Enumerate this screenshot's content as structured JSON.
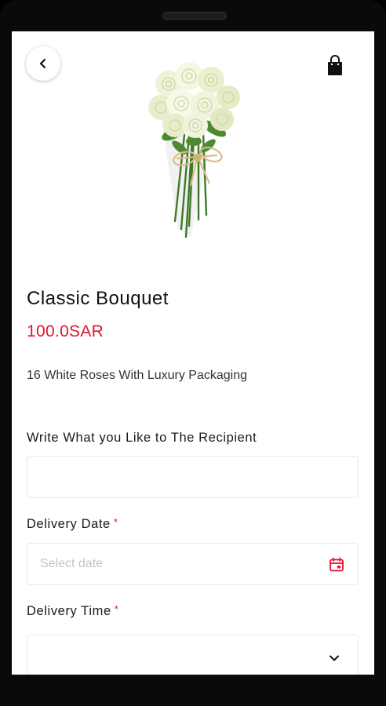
{
  "product": {
    "name": "Classic Bouquet",
    "price": "100.0SAR",
    "description": "16 White Roses With Luxury Packaging"
  },
  "form": {
    "message_label": "Write What you Like to The Recipient",
    "message_value": "",
    "date_label": "Delivery Date",
    "date_placeholder": "Select date",
    "time_label": "Delivery Time",
    "time_value": "",
    "required_mark": "*"
  },
  "icons": {
    "back": "chevron-left-icon",
    "bag": "shopping-bag-icon",
    "calendar": "calendar-icon",
    "dropdown": "chevron-down-icon"
  },
  "colors": {
    "accent": "#e3132b",
    "text": "#111111"
  }
}
